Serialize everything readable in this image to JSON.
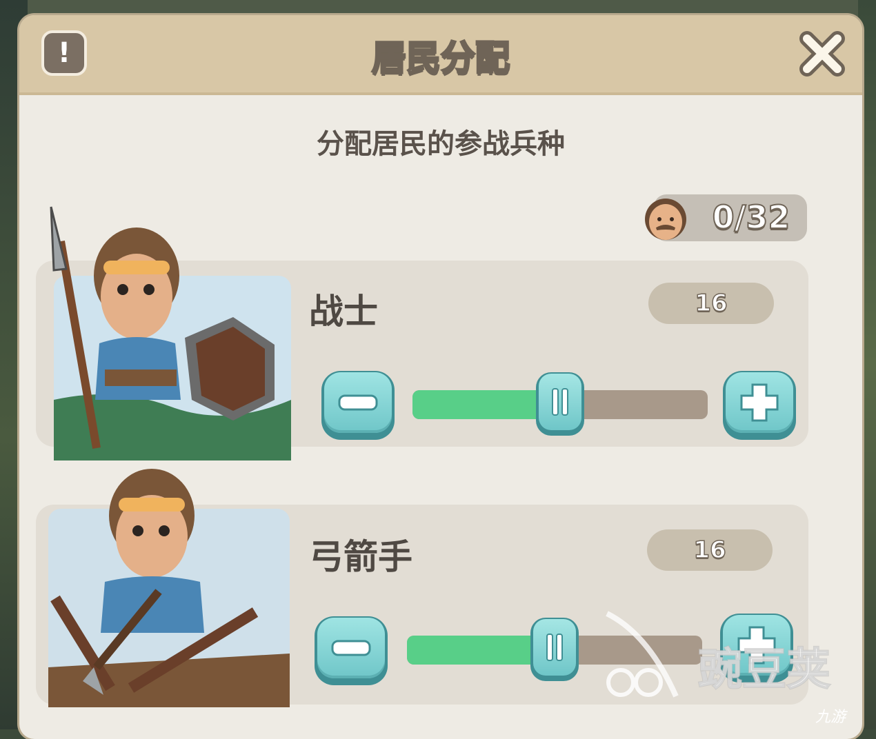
{
  "dialog": {
    "title": "居民分配",
    "subtitle": "分配居民的参战兵种"
  },
  "population": {
    "text": "0/32",
    "icon": "villager-face-icon"
  },
  "units": [
    {
      "name": "战士",
      "count": "16",
      "slider_fraction": 0.5,
      "icon": "spearman-shield-portrait"
    },
    {
      "name": "弓箭手",
      "count": "16",
      "slider_fraction": 0.5,
      "icon": "archer-crossbow-portrait"
    }
  ],
  "watermark": {
    "text": "豌豆荚",
    "small": "九游"
  },
  "colors": {
    "header": "#d8c7a6",
    "panel": "#eeebe4",
    "card": "#e2ddd4",
    "slider_fill": "#58cf88",
    "slider_track": "#a8998a",
    "button": "#6fc6c8"
  }
}
